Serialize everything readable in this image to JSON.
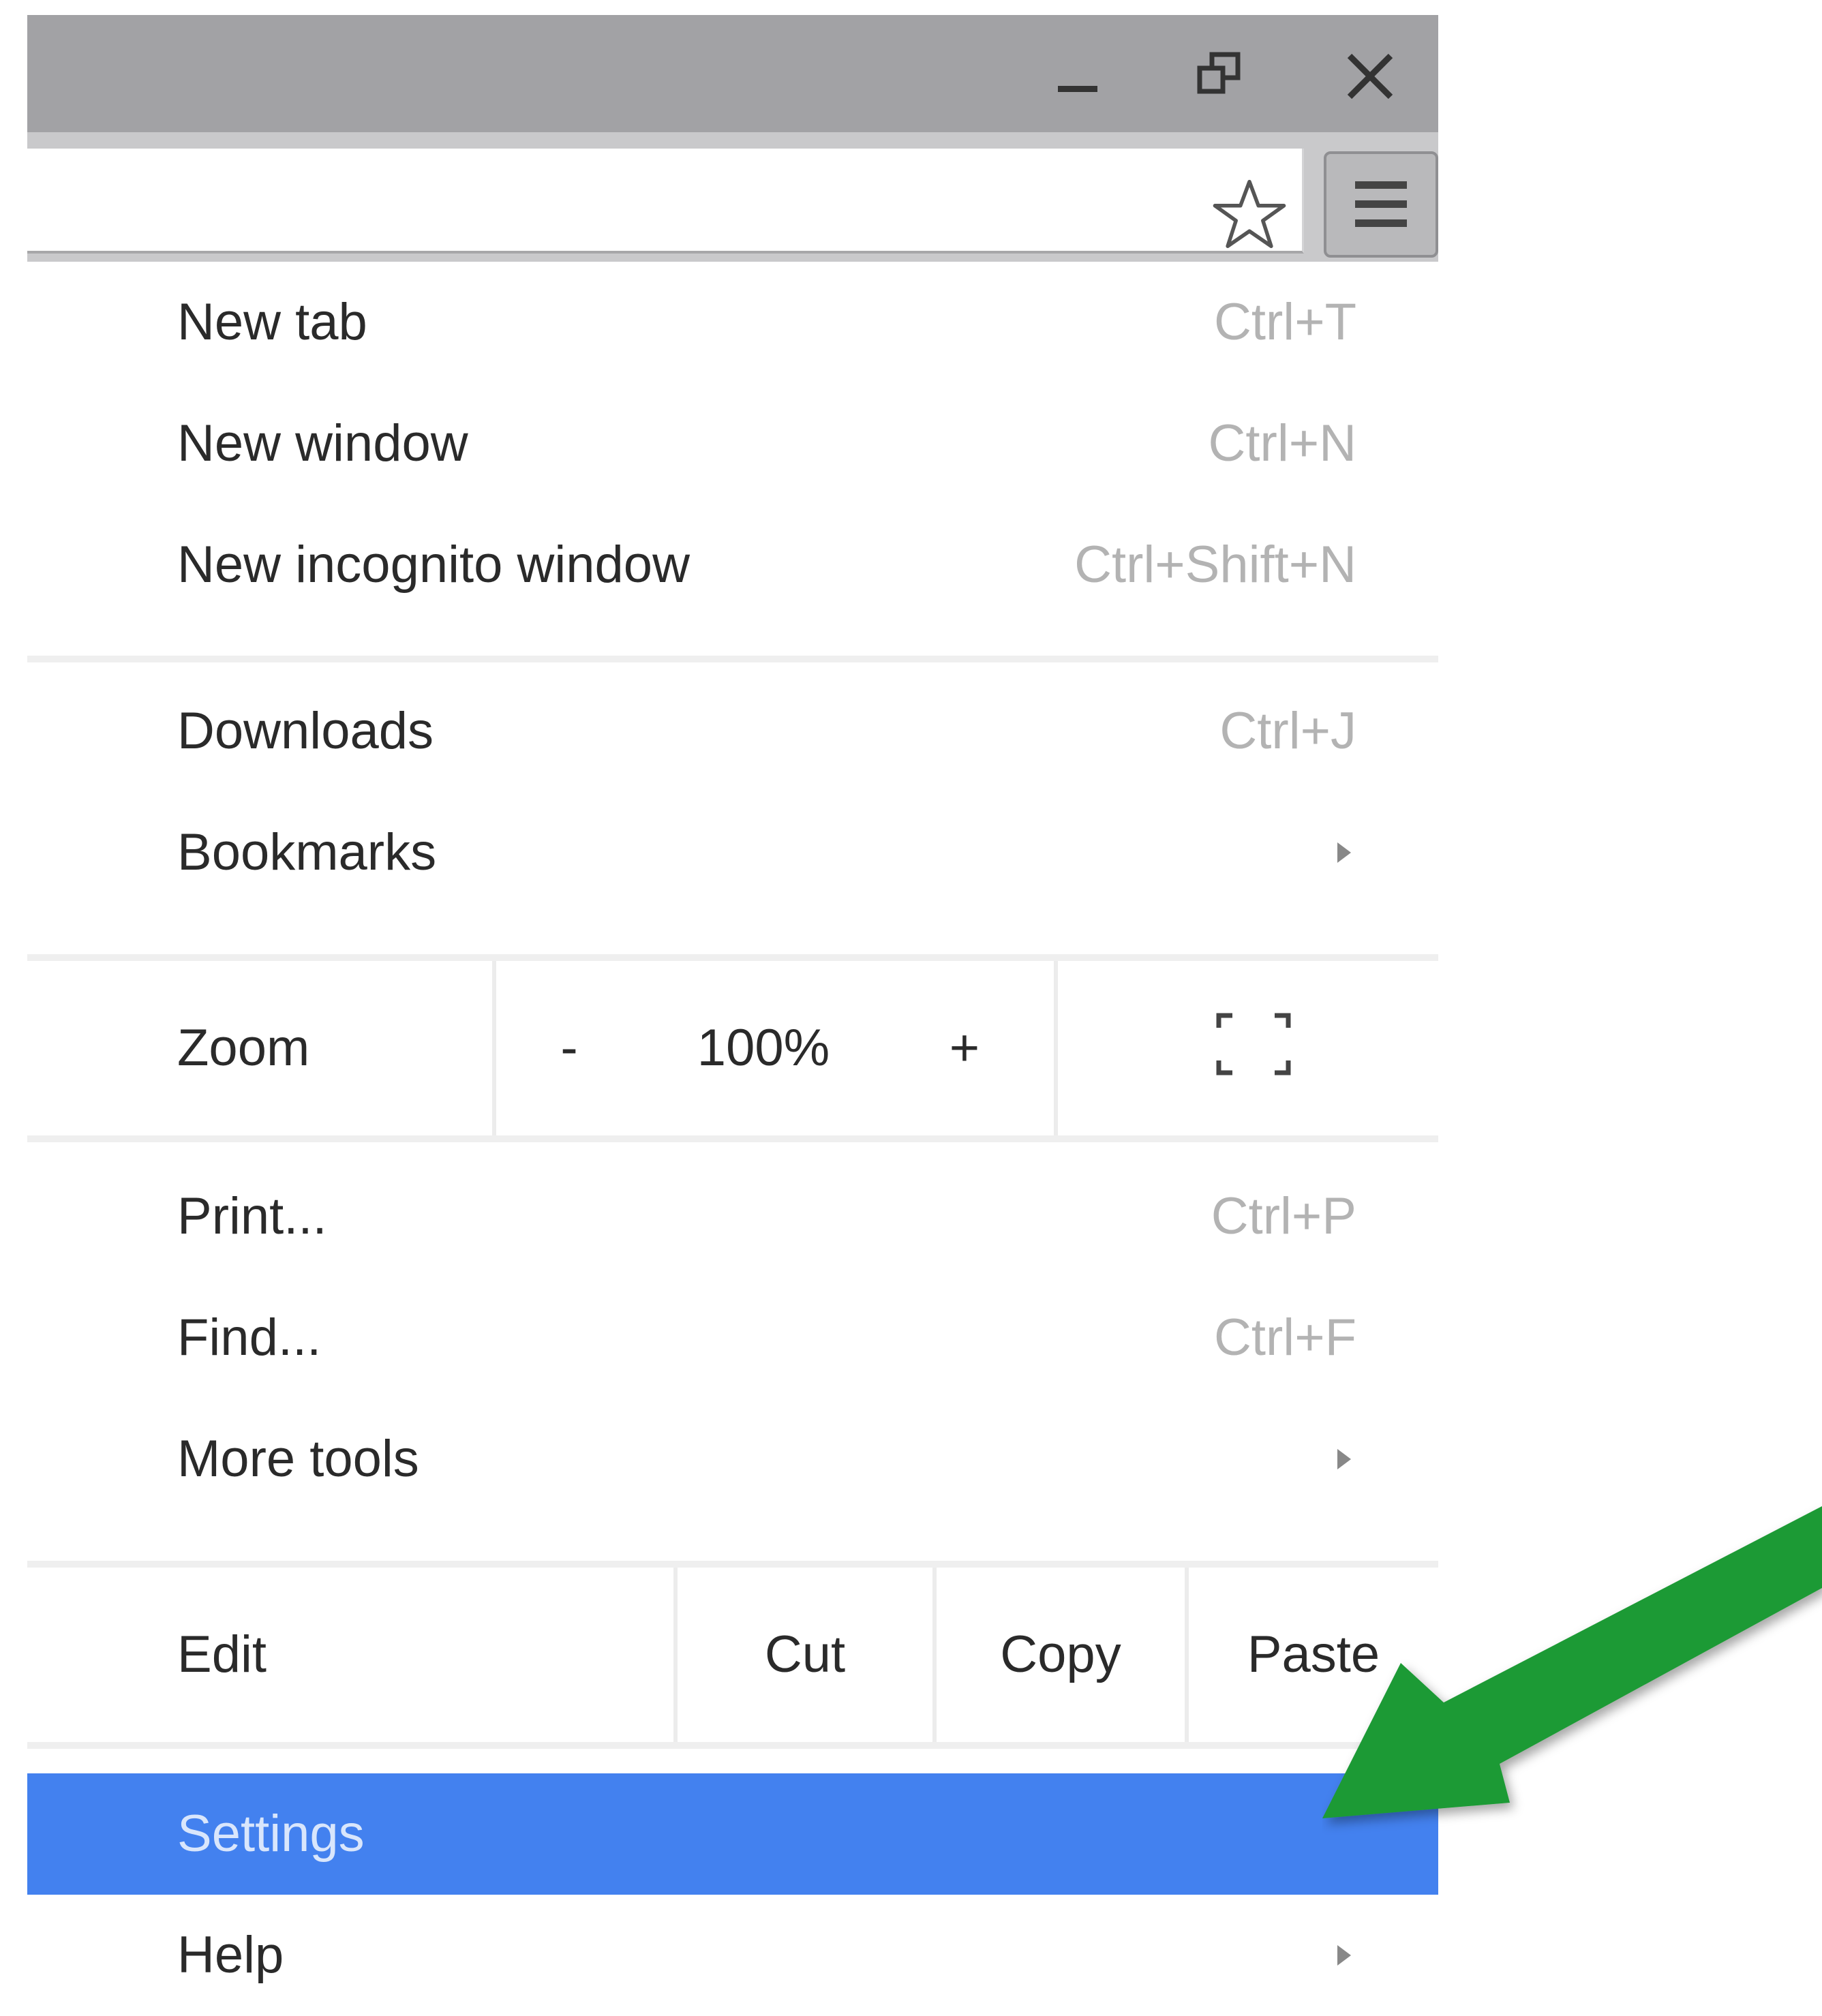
{
  "titlebar": {
    "minimize_icon": "minimize-icon",
    "restore_icon": "restore-icon",
    "close_icon": "close-icon"
  },
  "toolbar": {
    "bookmark_icon": "star-icon",
    "menu_icon": "hamburger-menu-icon"
  },
  "menu": {
    "new_tab": {
      "label": "New tab",
      "shortcut": "Ctrl+T"
    },
    "new_window": {
      "label": "New window",
      "shortcut": "Ctrl+N"
    },
    "new_incognito": {
      "label": "New incognito window",
      "shortcut": "Ctrl+Shift+N"
    },
    "downloads": {
      "label": "Downloads",
      "shortcut": "Ctrl+J"
    },
    "bookmarks": {
      "label": "Bookmarks"
    },
    "zoom": {
      "label": "Zoom",
      "minus": "-",
      "value": "100%",
      "plus": "+",
      "fullscreen_icon": "fullscreen-icon"
    },
    "print": {
      "label": "Print...",
      "shortcut": "Ctrl+P"
    },
    "find": {
      "label": "Find...",
      "shortcut": "Ctrl+F"
    },
    "more_tools": {
      "label": "More tools"
    },
    "edit": {
      "label": "Edit",
      "cut": "Cut",
      "copy": "Copy",
      "paste": "Paste"
    },
    "settings": {
      "label": "Settings"
    },
    "help": {
      "label": "Help"
    }
  },
  "colors": {
    "highlight": "#4381ef",
    "annotation_arrow": "#1f9a34"
  }
}
